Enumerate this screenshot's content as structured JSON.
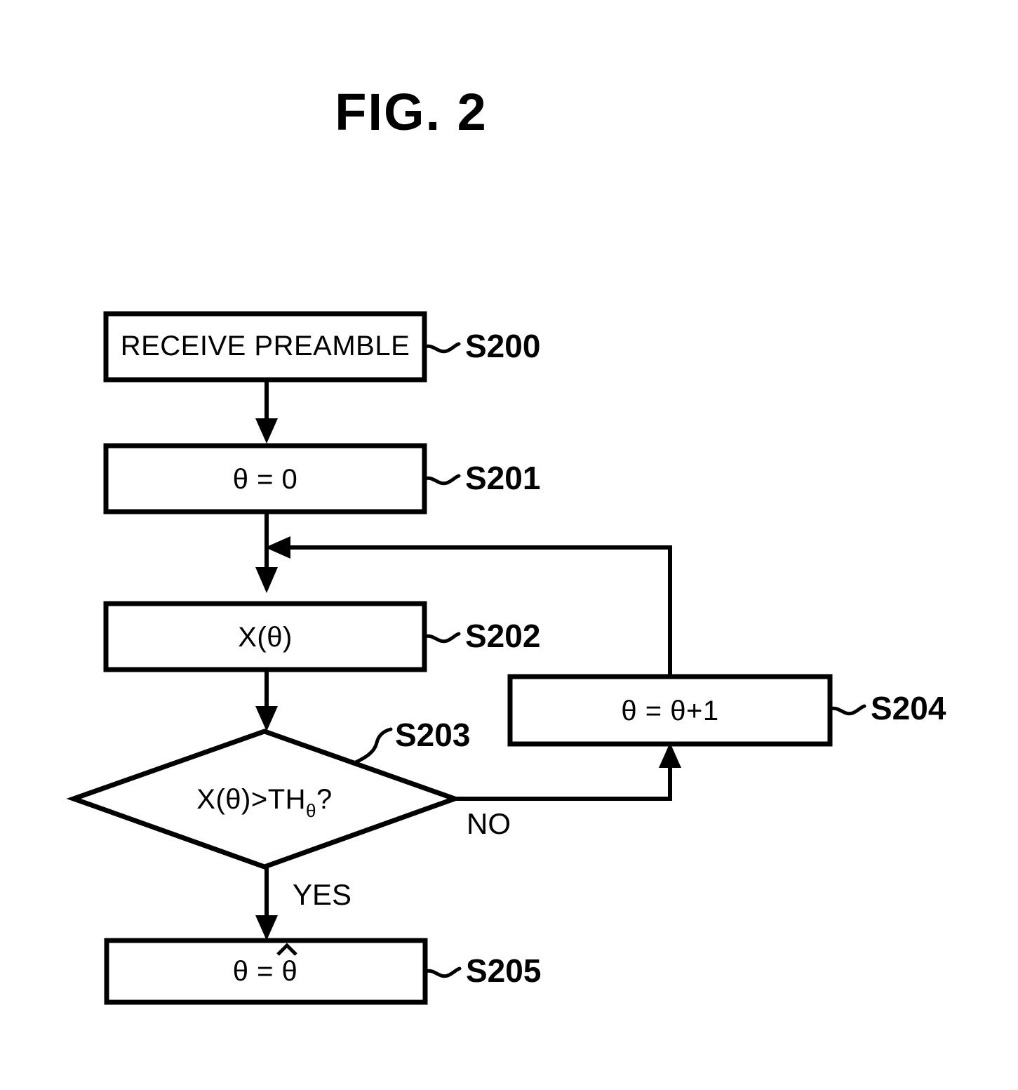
{
  "figure": {
    "title": "FIG. 2"
  },
  "flowchart": {
    "nodes": [
      {
        "id": "s200",
        "shape": "process",
        "text": "RECEIVE PREAMBLE",
        "ref": "S200"
      },
      {
        "id": "s201",
        "shape": "process",
        "text": "θ = 0",
        "ref": "S201"
      },
      {
        "id": "s202",
        "shape": "process",
        "text": "X(θ)",
        "ref": "S202"
      },
      {
        "id": "s203",
        "shape": "decision",
        "text_main": "X(θ)>TH",
        "text_sub": "θ",
        "text_tail": "?",
        "text": "X(θ)>THθ?",
        "ref": "S203"
      },
      {
        "id": "s204",
        "shape": "process",
        "text": "θ = θ+1",
        "ref": "S204"
      },
      {
        "id": "s205",
        "shape": "process",
        "text_lhs": "θ = ",
        "text_hat": "θ",
        "text": "θ = θ̂",
        "ref": "S205"
      }
    ],
    "branches": {
      "yes_label": "YES",
      "no_label": "NO"
    },
    "colors": {
      "ink": "#000000",
      "paper": "#ffffff"
    }
  }
}
